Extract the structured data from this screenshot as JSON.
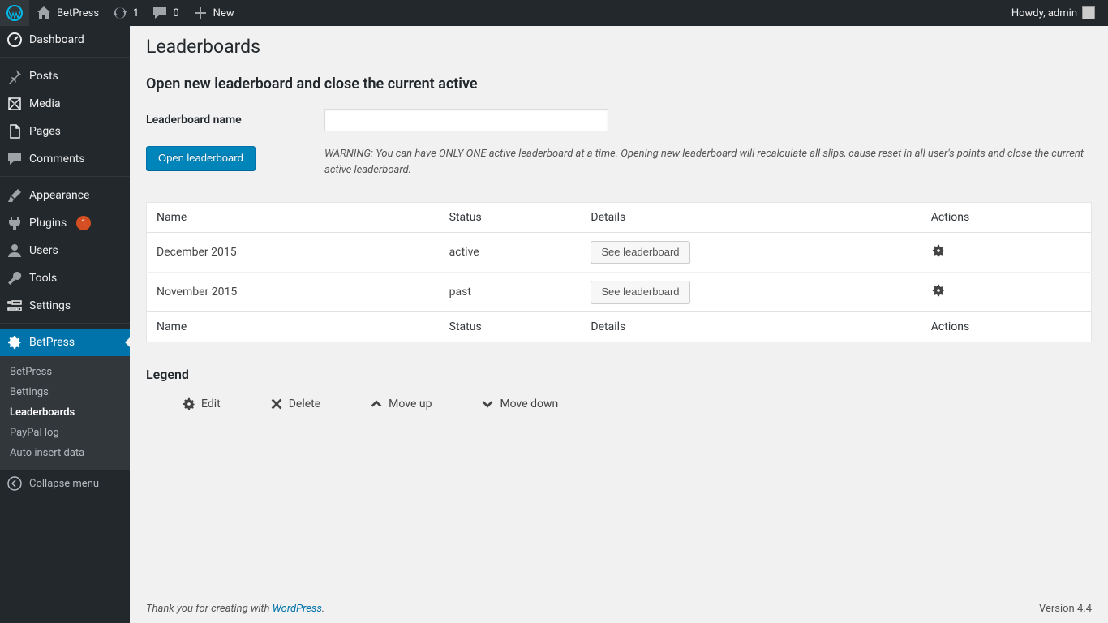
{
  "adminbar": {
    "site_name": "BetPress",
    "updates_count": "1",
    "comments_count": "0",
    "new_label": "New",
    "howdy": "Howdy, admin"
  },
  "sidebar": {
    "items": [
      {
        "label": "Dashboard"
      },
      {
        "label": "Posts"
      },
      {
        "label": "Media"
      },
      {
        "label": "Pages"
      },
      {
        "label": "Comments"
      },
      {
        "label": "Appearance"
      },
      {
        "label": "Plugins",
        "badge": "1"
      },
      {
        "label": "Users"
      },
      {
        "label": "Tools"
      },
      {
        "label": "Settings"
      },
      {
        "label": "BetPress"
      }
    ],
    "submenu": [
      {
        "label": "BetPress"
      },
      {
        "label": "Bettings"
      },
      {
        "label": "Leaderboards"
      },
      {
        "label": "PayPal log"
      },
      {
        "label": "Auto insert data"
      }
    ],
    "collapse_label": "Collapse menu"
  },
  "page": {
    "title": "Leaderboards",
    "section": "Open new leaderboard and close the current active",
    "form_label": "Leaderboard name",
    "submit_label": "Open leaderboard",
    "warning": "WARNING: You can have ONLY ONE active leaderboard at a time. Opening new leaderboard will recalculate all slips, cause reset in all user's points and close the current active leaderboard."
  },
  "table": {
    "columns": {
      "name": "Name",
      "status": "Status",
      "details": "Details",
      "actions": "Actions"
    },
    "rows": [
      {
        "name": "December 2015",
        "status": "active",
        "details_btn": "See leaderboard"
      },
      {
        "name": "November 2015",
        "status": "past",
        "details_btn": "See leaderboard"
      }
    ]
  },
  "legend": {
    "title": "Legend",
    "edit": "Edit",
    "delete": "Delete",
    "move_up": "Move up",
    "move_down": "Move down"
  },
  "footer": {
    "thanks_prefix": "Thank you for creating with ",
    "thanks_link": "WordPress",
    "thanks_suffix": ".",
    "version": "Version 4.4"
  }
}
